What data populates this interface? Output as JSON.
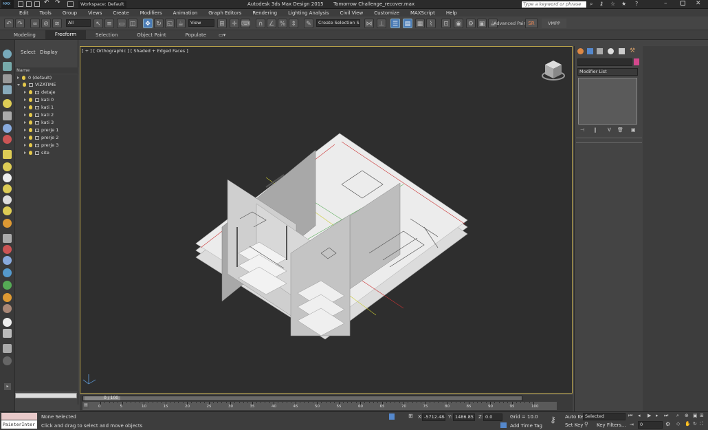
{
  "title": {
    "app": "Autodesk 3ds Max Design 2015",
    "file": "Tomorrow Challenge_recover.max",
    "workspace": "Workspace: Default",
    "search_placeholder": "Type a keyword or phrase"
  },
  "menu": [
    "Edit",
    "Tools",
    "Group",
    "Views",
    "Create",
    "Modifiers",
    "Animation",
    "Graph Editors",
    "Rendering",
    "Lighting Analysis",
    "Civil View",
    "Customize",
    "MAXScript",
    "Help"
  ],
  "toolbar": {
    "filter": "All",
    "ref_coord": "View",
    "selection_set": "Create Selection Se",
    "advanced_paint": "Advanced Paint",
    "sr": "SR",
    "vmpp": "VMPP"
  },
  "ribbon": {
    "tabs": [
      "Modeling",
      "Freeform",
      "Selection",
      "Object Paint",
      "Populate"
    ]
  },
  "scene_explorer": {
    "tabs": [
      "Select",
      "Display"
    ],
    "column": "Name",
    "items": [
      {
        "label": "0 (default)",
        "level": 0,
        "expanded": false
      },
      {
        "label": "VIZATIME",
        "level": 0,
        "expanded": true
      },
      {
        "label": "detaje",
        "level": 1,
        "expanded": false
      },
      {
        "label": "kati 0",
        "level": 1,
        "expanded": false
      },
      {
        "label": "kati 1",
        "level": 1,
        "expanded": false
      },
      {
        "label": "kati 2",
        "level": 1,
        "expanded": false
      },
      {
        "label": "kati 3",
        "level": 1,
        "expanded": false
      },
      {
        "label": "prerje 1",
        "level": 1,
        "expanded": false
      },
      {
        "label": "prerje 2",
        "level": 1,
        "expanded": false
      },
      {
        "label": "prerje 3",
        "level": 1,
        "expanded": false
      },
      {
        "label": "site",
        "level": 1,
        "expanded": false
      }
    ]
  },
  "viewport": {
    "label": "[ + ] [ Orthographic ] [ Shaded + Edged Faces ]"
  },
  "command_panel": {
    "modifier_list": "Modifier List"
  },
  "timeline": {
    "frame": "0 / 100",
    "ticks": [
      "0",
      "5",
      "10",
      "15",
      "20",
      "25",
      "30",
      "35",
      "40",
      "45",
      "50",
      "55",
      "60",
      "65",
      "70",
      "75",
      "80",
      "85",
      "90",
      "95",
      "100"
    ]
  },
  "status": {
    "selection": "None Selected",
    "prompt": "Click and drag to select and move objects",
    "maxscript": "PainterInter",
    "x_label": "X:",
    "x": "-5712.484",
    "y_label": "Y:",
    "y": "1486.857",
    "z_label": "Z:",
    "z": "0.0",
    "grid": "Grid = 10.0",
    "add_time_tag": "Add Time Tag",
    "auto_key": "Auto Key",
    "set_key": "Set Key",
    "key_mode": "Selected",
    "key_filters": "Key Filters...",
    "frame_value": "0"
  },
  "colors": {
    "accent": "#4a7bb5",
    "viewport_border": "#b8a24a",
    "bulb": "#e4c84a"
  }
}
